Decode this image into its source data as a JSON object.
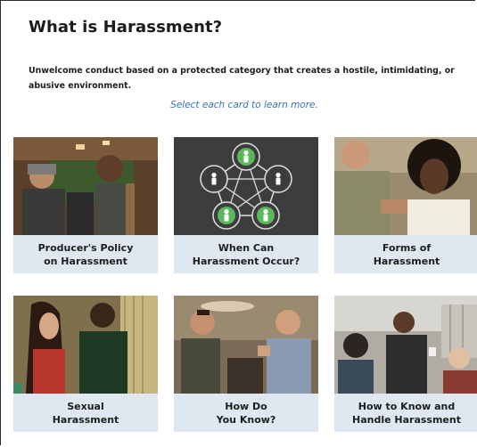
{
  "header": {
    "title": "What is Harassment?",
    "description": "Unwelcome conduct based on a protected category that creates a hostile, intimidating, or abusive environment.",
    "instruction": "Select each card to learn more."
  },
  "cards": [
    {
      "line1": "Producer's Policy",
      "line2": "on Harassment"
    },
    {
      "line1": "When Can",
      "line2": "Harassment Occur?"
    },
    {
      "line1": "Forms of",
      "line2": "Harassment"
    },
    {
      "line1": "Sexual",
      "line2": "Harassment"
    },
    {
      "line1": "How Do",
      "line2": "You Know?"
    },
    {
      "line1": "How to Know and",
      "line2": "Handle Harassment"
    }
  ],
  "colors": {
    "card_label_bg": "#dfe8f1",
    "instruction_text": "#3a6fb8",
    "diagram_bg": "#3d3d3d",
    "diagram_accent": "#5cb85c"
  },
  "icons": {
    "card2": "person-network-diagram-icon"
  }
}
